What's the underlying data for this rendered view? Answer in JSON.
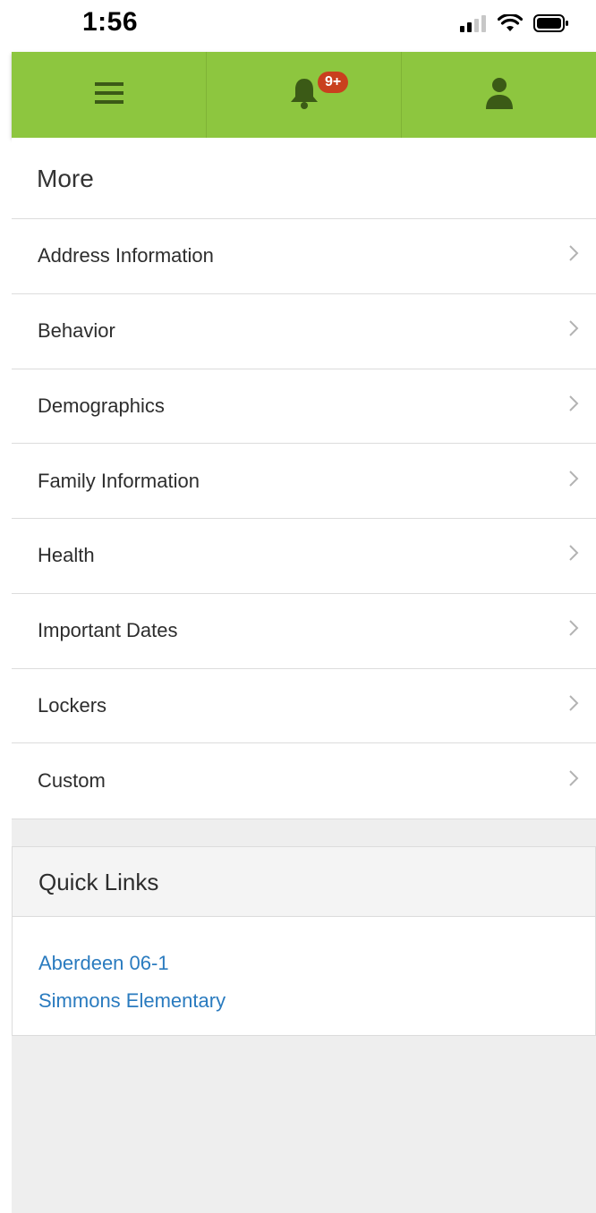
{
  "status_bar": {
    "time": "1:56"
  },
  "app_bar": {
    "background": "#8dc63f",
    "icon_color": "#3b5a16",
    "notification_badge": "9+",
    "badge_color": "#c9401e"
  },
  "page_title": "More",
  "menu_items": [
    {
      "label": "Address Information"
    },
    {
      "label": "Behavior"
    },
    {
      "label": "Demographics"
    },
    {
      "label": "Family Information"
    },
    {
      "label": "Health"
    },
    {
      "label": "Important Dates"
    },
    {
      "label": "Lockers"
    },
    {
      "label": "Custom"
    }
  ],
  "quick_links": {
    "title": "Quick Links",
    "links": [
      {
        "label": "Aberdeen 06-1"
      },
      {
        "label": "Simmons Elementary"
      }
    ],
    "link_color": "#2a7bbf"
  }
}
